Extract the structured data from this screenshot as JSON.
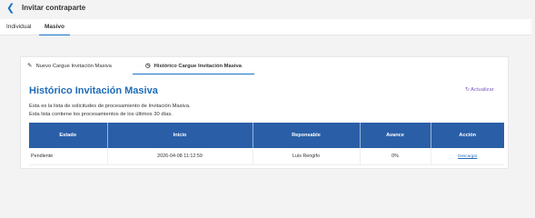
{
  "header": {
    "title": "Invitar contraparte"
  },
  "tabs": [
    {
      "label": "Individual"
    },
    {
      "label": "Masivo"
    }
  ],
  "subtabs": [
    {
      "label": "Nuevo Cargue Invitación Masiva",
      "icon": "pencil-icon"
    },
    {
      "label": "Histórico Cargue Invitación Masiva",
      "icon": "history-icon"
    }
  ],
  "section": {
    "title": "Histórico Invitación Masiva",
    "refresh_label": "Actualizar",
    "desc_line1": "Esta es la lista de solicitudes de procesamiento de Invitación Masiva.",
    "desc_line2": "Esta lista contiene los procesamientos de los últimos 30 días."
  },
  "table": {
    "headers": [
      "Estado",
      "Inicio",
      "Reponsable",
      "Avance",
      "Acción"
    ],
    "rows": [
      [
        "Pendiente",
        "2026-04-08 11:12:59",
        "Luis Rengifo",
        "0%",
        "Descargar"
      ]
    ]
  },
  "colors": {
    "accent": "#1e6bb8",
    "table_header": "#2a5fa8",
    "refresh": "#7b5ac7"
  }
}
